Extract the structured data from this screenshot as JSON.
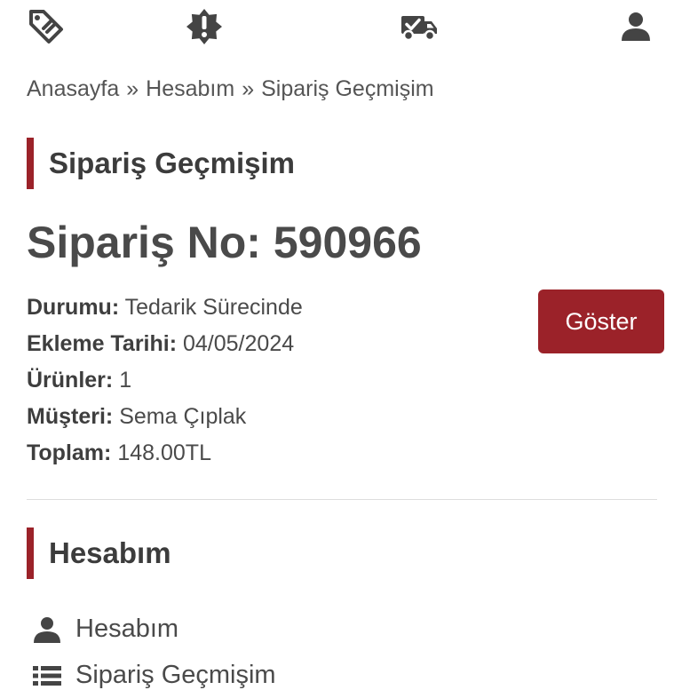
{
  "header": {
    "icons": [
      "tag-icon",
      "alert-badge-icon",
      "delivery-truck-icon",
      "user-icon"
    ]
  },
  "breadcrumb": {
    "items": [
      "Anasayfa",
      "Hesabım",
      "Sipariş Geçmişim"
    ],
    "separator": "»"
  },
  "page_title": "Sipariş Geçmişim",
  "order": {
    "number_label": "Sipariş No:",
    "number": "590966",
    "fields": [
      {
        "label": "Durumu:",
        "value": "Tedarik Sürecinde"
      },
      {
        "label": "Ekleme Tarihi:",
        "value": "04/05/2024"
      },
      {
        "label": "Ürünler:",
        "value": "1"
      },
      {
        "label": "Müşteri:",
        "value": "Sema Çıplak"
      },
      {
        "label": "Toplam:",
        "value": "148.00TL"
      }
    ],
    "show_button_label": "Göster"
  },
  "account_section": {
    "title": "Hesabım",
    "items": [
      {
        "label": "Hesabım",
        "icon": "user-icon"
      },
      {
        "label": "Sipariş Geçmişim",
        "icon": "list-icon"
      }
    ]
  },
  "colors": {
    "accent": "#9b2229",
    "icon": "#444444",
    "text": "#4a4a4a"
  }
}
